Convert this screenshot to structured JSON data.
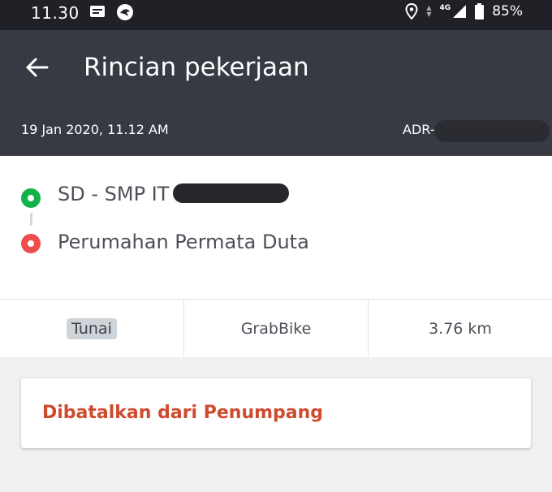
{
  "status_bar": {
    "time": "11.30",
    "network": "4G",
    "battery": "85%"
  },
  "app_bar": {
    "title": "Rincian pekerjaan",
    "date_time": "19 Jan 2020, 11.12 AM",
    "order_id_prefix": "ADR-"
  },
  "route": {
    "pickup": "SD - SMP IT",
    "dropoff": "Perumahan Permata Duta"
  },
  "trip_info": {
    "payment": "Tunai",
    "service": "GrabBike",
    "distance": "3.76 km"
  },
  "status_card": {
    "message": "Dibatalkan dari Penumpang"
  },
  "colors": {
    "app_bar": "#373a43",
    "pickup_dot": "#12b24a",
    "dropoff_dot": "#ef4d4d",
    "cancel_text": "#cf4a2e"
  }
}
